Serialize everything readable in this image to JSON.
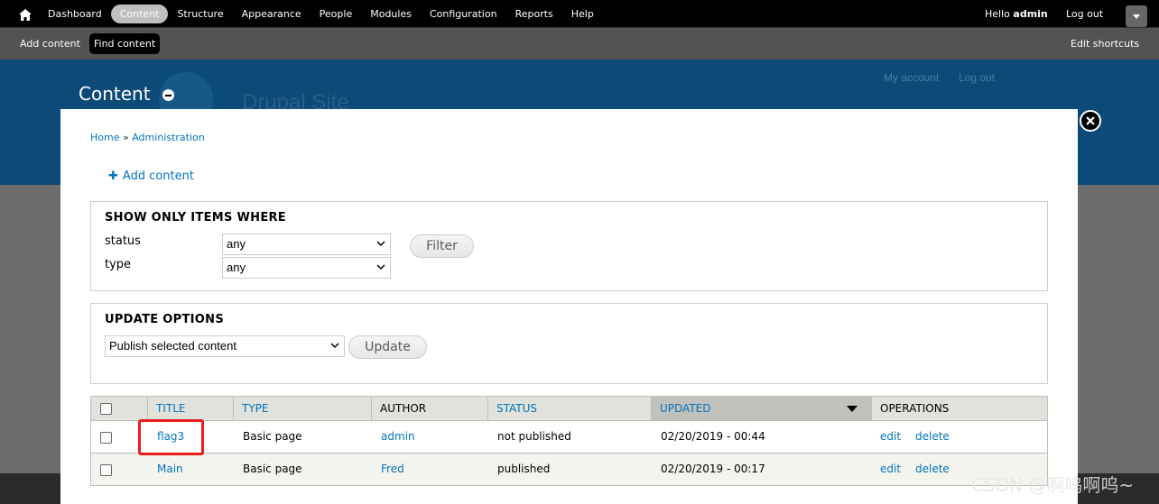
{
  "toolbar": {
    "menu": [
      {
        "label": "Dashboard",
        "active": false
      },
      {
        "label": "Content",
        "active": true
      },
      {
        "label": "Structure",
        "active": false
      },
      {
        "label": "Appearance",
        "active": false
      },
      {
        "label": "People",
        "active": false
      },
      {
        "label": "Modules",
        "active": false
      },
      {
        "label": "Configuration",
        "active": false
      },
      {
        "label": "Reports",
        "active": false
      },
      {
        "label": "Help",
        "active": false
      }
    ],
    "hello_prefix": "Hello",
    "user": "admin",
    "logout": "Log out"
  },
  "shortcuts": {
    "add_content": "Add content",
    "find_content": "Find content",
    "edit_shortcuts": "Edit shortcuts"
  },
  "background": {
    "site_name": "Drupal Site",
    "my_account": "My account",
    "log_out": "Log out"
  },
  "overlay": {
    "title": "Content",
    "breadcrumb": {
      "home": "Home",
      "separator": "»",
      "admin": "Administration"
    },
    "add_content": "Add content",
    "filter": {
      "heading": "SHOW ONLY ITEMS WHERE",
      "status_label": "status",
      "status_value": "any",
      "type_label": "type",
      "type_value": "any",
      "button": "Filter"
    },
    "update": {
      "heading": "UPDATE OPTIONS",
      "action_value": "Publish selected content",
      "button": "Update"
    },
    "table": {
      "headers": {
        "title": "TITLE",
        "type": "TYPE",
        "author": "AUTHOR",
        "status": "STATUS",
        "updated": "UPDATED",
        "operations": "OPERATIONS"
      },
      "rows": [
        {
          "title": "flag3",
          "type": "Basic page",
          "author": "admin",
          "status": "not published",
          "updated": "02/20/2019 - 00:44",
          "edit": "edit",
          "delete": "delete"
        },
        {
          "title": "Main",
          "type": "Basic page",
          "author": "Fred",
          "status": "published",
          "updated": "02/20/2019 - 00:17",
          "edit": "edit",
          "delete": "delete"
        }
      ]
    }
  },
  "watermark": "CSDN @啊呜啊呜~",
  "colors": {
    "link": "#0074bd",
    "highlight": "#ec1d1d",
    "header_bg": "#0c4a78"
  }
}
